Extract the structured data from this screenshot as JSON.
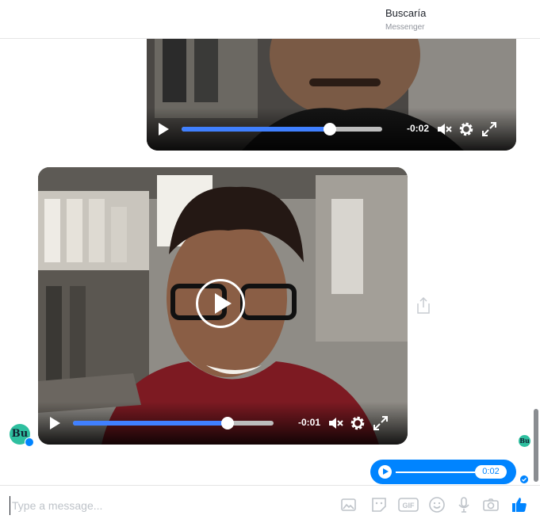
{
  "header": {
    "title": "Buscaría",
    "subtitle": "Messenger"
  },
  "video_top": {
    "time": "-0:02",
    "progress": 0.74
  },
  "video_main": {
    "time": "-0:01",
    "progress": 0.77
  },
  "avatar": {
    "initials": "Bu",
    "color": "#2ebf9f"
  },
  "audio_message": {
    "time": "0:02"
  },
  "composer": {
    "placeholder": "Type a message..."
  },
  "icons": [
    "play-icon",
    "mute-icon",
    "gear-icon",
    "fullscreen-icon",
    "share-icon",
    "photo-icon",
    "sticker-icon",
    "gif-icon",
    "emoji-icon",
    "microphone-icon",
    "camera-icon",
    "like-icon"
  ],
  "colors": {
    "accent": "#0084ff",
    "progress": "#4080ff"
  }
}
